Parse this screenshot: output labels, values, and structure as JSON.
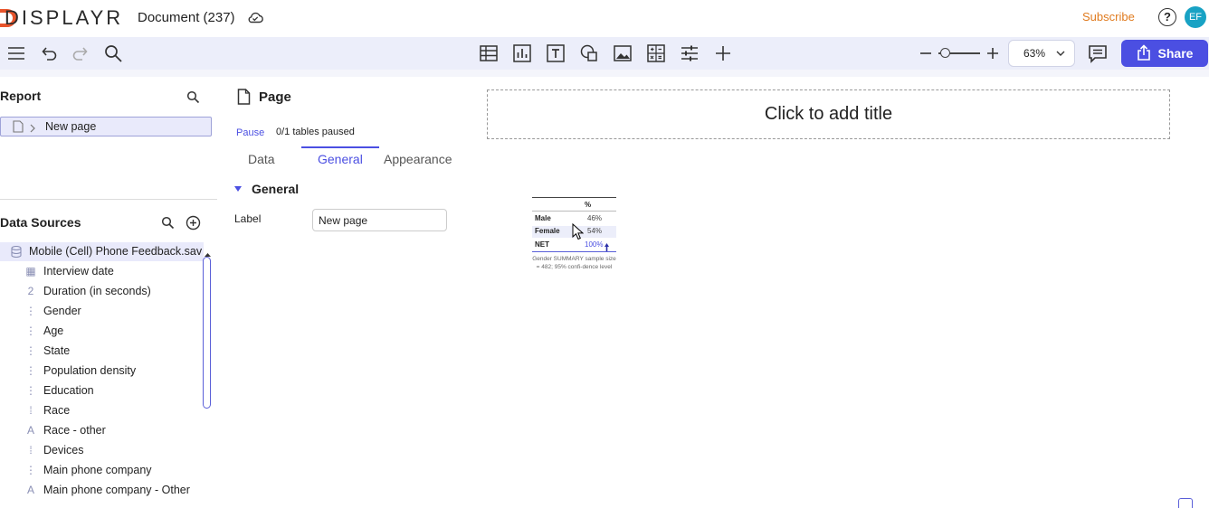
{
  "app": {
    "logo_text": "DISPLAYR",
    "document_title": "Document (237)",
    "subscribe_label": "Subscribe",
    "help_label": "?",
    "avatar_initials": "EF"
  },
  "toolbar": {
    "zoom_value": "63%",
    "share_label": "Share"
  },
  "report": {
    "heading": "Report",
    "pages": [
      {
        "label": "New page"
      }
    ]
  },
  "data_sources": {
    "heading": "Data Sources",
    "file_label": "Mobile (Cell) Phone Feedback.sav",
    "variables": [
      {
        "label": "Interview date",
        "icon": "calendar-icon",
        "glyph": "▦"
      },
      {
        "label": "Duration (in seconds)",
        "icon": "numeric-icon",
        "glyph": "2"
      },
      {
        "label": "Gender",
        "icon": "categorical-icon",
        "glyph": "⋮"
      },
      {
        "label": "Age",
        "icon": "categorical-icon",
        "glyph": "⋮"
      },
      {
        "label": "State",
        "icon": "categorical-icon",
        "glyph": "⋮"
      },
      {
        "label": "Population density",
        "icon": "categorical-icon",
        "glyph": "⋮"
      },
      {
        "label": "Education",
        "icon": "categorical-icon",
        "glyph": "⋮"
      },
      {
        "label": "Race",
        "icon": "multi-icon",
        "glyph": "⁞"
      },
      {
        "label": "Race - other",
        "icon": "text-icon",
        "glyph": "A"
      },
      {
        "label": "Devices",
        "icon": "multi-icon",
        "glyph": "⁞"
      },
      {
        "label": "Main phone company",
        "icon": "categorical-icon",
        "glyph": "⋮"
      },
      {
        "label": "Main phone company - Other",
        "icon": "text-icon",
        "glyph": "A"
      }
    ]
  },
  "page_panel": {
    "heading": "Page",
    "pause_label": "Pause",
    "pause_status": "0/1 tables paused",
    "tabs": [
      {
        "label": "Data"
      },
      {
        "label": "General"
      },
      {
        "label": "Appearance"
      }
    ],
    "active_tab": "General",
    "section_heading": "General",
    "label_field_label": "Label",
    "label_field_value": "New page"
  },
  "canvas": {
    "title_placeholder": "Click to add title",
    "mini_table": {
      "header": "%",
      "rows": [
        {
          "label": "Male",
          "value": "46%"
        },
        {
          "label": "Female",
          "value": "54%"
        },
        {
          "label": "NET",
          "value": "100%"
        }
      ],
      "footer": "Gender SUMMARY sample size = 482; 95% confi-dence level"
    }
  },
  "colors": {
    "accent": "#4b4fe2",
    "subscribe": "#e07b1f",
    "avatar_bg": "#18a2c4",
    "toolbar_bg": "#eceefa"
  }
}
